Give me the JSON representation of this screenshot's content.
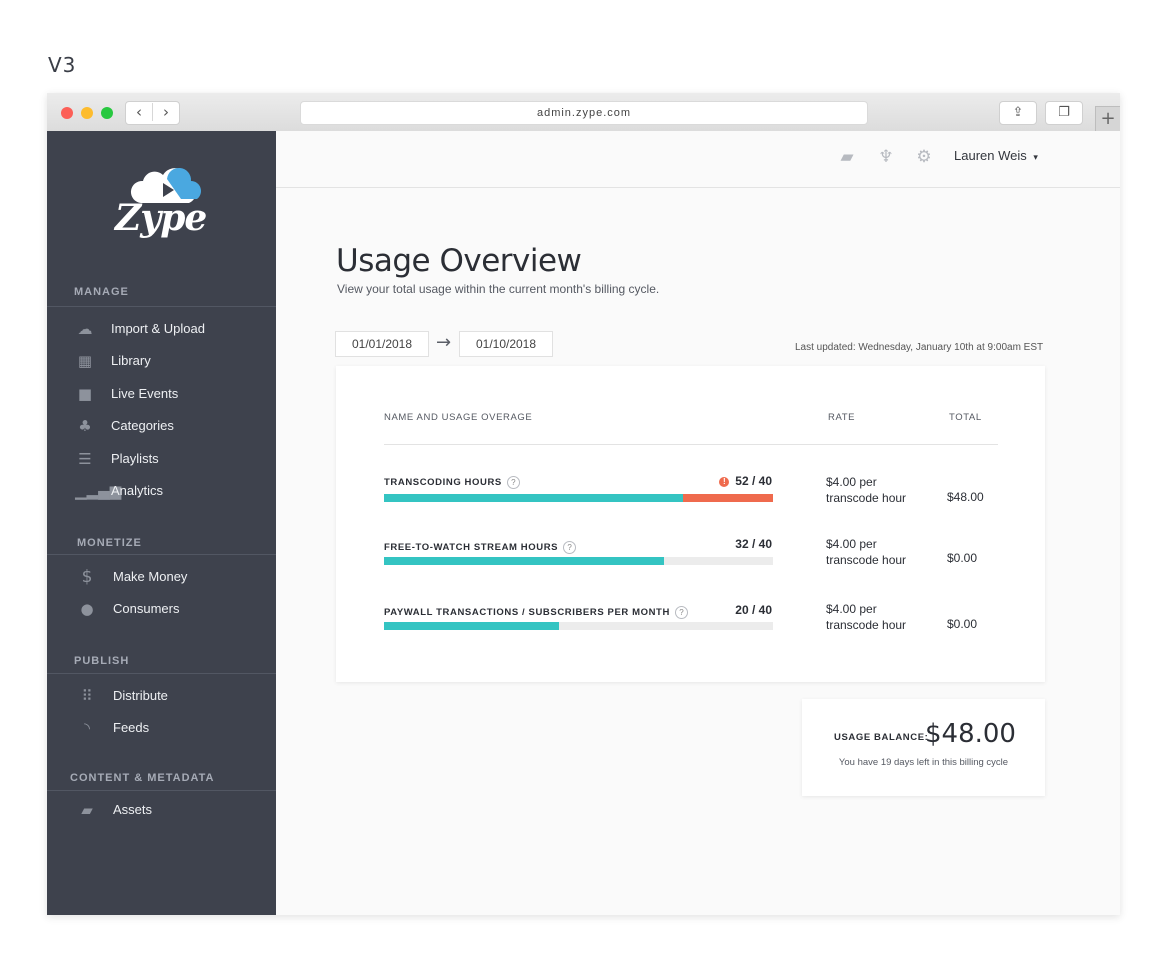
{
  "version_label": "V3",
  "browser": {
    "url": "admin.zype.com",
    "back": "‹",
    "forward": "›",
    "share": "⇪",
    "tabs": "❐",
    "new_tab": "+"
  },
  "brand": {
    "name": "Zype"
  },
  "sidebar": {
    "sections": [
      {
        "title": "MANAGE",
        "items": [
          {
            "label": "Import & Upload",
            "icon": "cloud-upload-icon"
          },
          {
            "label": "Library",
            "icon": "film-icon"
          },
          {
            "label": "Live Events",
            "icon": "video-camera-icon"
          },
          {
            "label": "Categories",
            "icon": "sitemap-icon"
          },
          {
            "label": "Playlists",
            "icon": "list-icon"
          },
          {
            "label": "Analytics",
            "icon": "signal-bars-icon"
          }
        ]
      },
      {
        "title": "MONETIZE",
        "items": [
          {
            "label": "Make Money",
            "icon": "dollar-icon"
          },
          {
            "label": "Consumers",
            "icon": "user-icon"
          }
        ]
      },
      {
        "title": "PUBLISH",
        "items": [
          {
            "label": "Distribute",
            "icon": "grid-icon"
          },
          {
            "label": "Feeds",
            "icon": "rss-icon"
          }
        ]
      },
      {
        "title": "CONTENT & METADATA",
        "items": [
          {
            "label": "Assets",
            "icon": "folder-open-icon"
          }
        ]
      }
    ]
  },
  "topbar": {
    "icons": [
      "book-icon",
      "trophy-icon",
      "gears-icon"
    ],
    "user_name": "Lauren Weis"
  },
  "main": {
    "title": "Usage Overview",
    "subtitle": "View your total usage within the current month's billing cycle.",
    "date_from": "01/01/2018",
    "date_to": "01/10/2018",
    "last_updated": "Last updated: Wednesday, January 10th at 9:00am EST",
    "table": {
      "headers": {
        "name": "NAME AND USAGE OVERAGE",
        "rate": "RATE",
        "total": "TOTAL"
      },
      "rows": [
        {
          "name": "TRANSCODING HOURS",
          "used": 52,
          "limit": 40,
          "value": "52 / 40",
          "overage": true,
          "rate_line1": "$4.00 per",
          "rate_line2": "transcode hour",
          "total": "$48.00"
        },
        {
          "name": "FREE-TO-WATCH STREAM HOURS",
          "used": 32,
          "limit": 40,
          "value": "32 / 40",
          "overage": false,
          "rate_line1": "$4.00 per",
          "rate_line2": "transcode hour",
          "total": "$0.00"
        },
        {
          "name": "PAYWALL TRANSACTIONS / SUBSCRIBERS PER MONTH",
          "used": 20,
          "limit": 40,
          "value": "20 / 40",
          "overage": false,
          "rate_line1": "$4.00 per",
          "rate_line2": "transcode hour",
          "total": "$0.00"
        }
      ]
    },
    "balance": {
      "label": "USAGE BALANCE:",
      "amount": "$48.00",
      "note": "You have 19 days left in this billing cycle"
    }
  },
  "colors": {
    "sidebar_bg": "#3e424d",
    "bar_fill": "#34c4c2",
    "bar_overage": "#ef6a4d",
    "bar_track": "#ececec"
  }
}
